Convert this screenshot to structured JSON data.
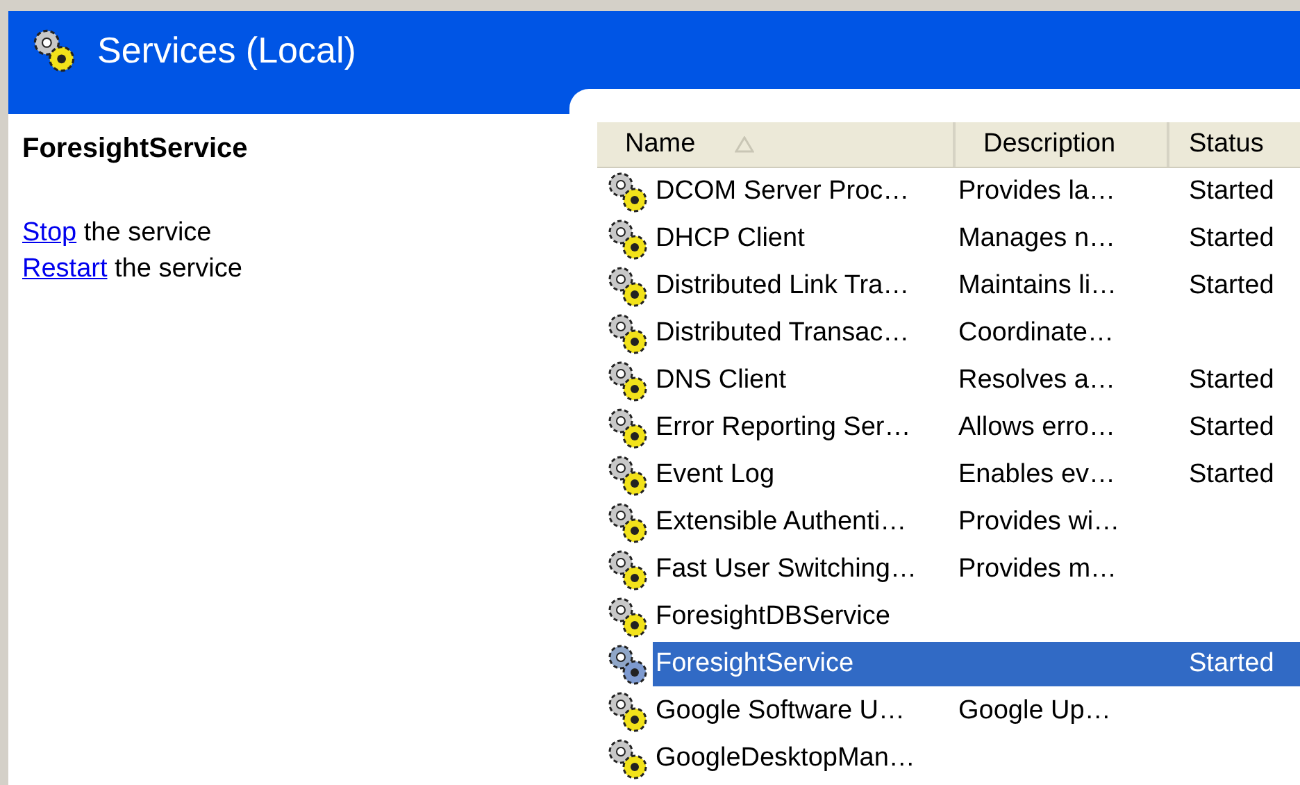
{
  "header": {
    "title": "Services (Local)"
  },
  "details": {
    "service_name": "ForesightService",
    "actions": [
      {
        "link": "Stop",
        "text": "the service"
      },
      {
        "link": "Restart",
        "text": "the service"
      }
    ]
  },
  "table": {
    "columns": [
      {
        "label": "Name",
        "sorted": true
      },
      {
        "label": "Description",
        "sorted": false
      },
      {
        "label": "Status",
        "sorted": false
      }
    ],
    "rows": [
      {
        "name": "DCOM Server Proc…",
        "description": "Provides la…",
        "status": "Started",
        "selected": false
      },
      {
        "name": "DHCP Client",
        "description": "Manages n…",
        "status": "Started",
        "selected": false
      },
      {
        "name": "Distributed Link Tra…",
        "description": "Maintains li…",
        "status": "Started",
        "selected": false
      },
      {
        "name": "Distributed Transac…",
        "description": "Coordinate…",
        "status": "",
        "selected": false
      },
      {
        "name": "DNS Client",
        "description": "Resolves a…",
        "status": "Started",
        "selected": false
      },
      {
        "name": "Error Reporting Ser…",
        "description": "Allows erro…",
        "status": "Started",
        "selected": false
      },
      {
        "name": "Event Log",
        "description": "Enables ev…",
        "status": "Started",
        "selected": false
      },
      {
        "name": "Extensible Authenti…",
        "description": "Provides wi…",
        "status": "",
        "selected": false
      },
      {
        "name": "Fast User Switching…",
        "description": "Provides m…",
        "status": "",
        "selected": false
      },
      {
        "name": "ForesightDBService",
        "description": "",
        "status": "",
        "selected": false
      },
      {
        "name": "ForesightService",
        "description": "",
        "status": "Started",
        "selected": true
      },
      {
        "name": "Google Software U…",
        "description": "Google Up…",
        "status": "",
        "selected": false
      },
      {
        "name": "GoogleDesktopMan…",
        "description": "",
        "status": "",
        "selected": false
      }
    ]
  }
}
